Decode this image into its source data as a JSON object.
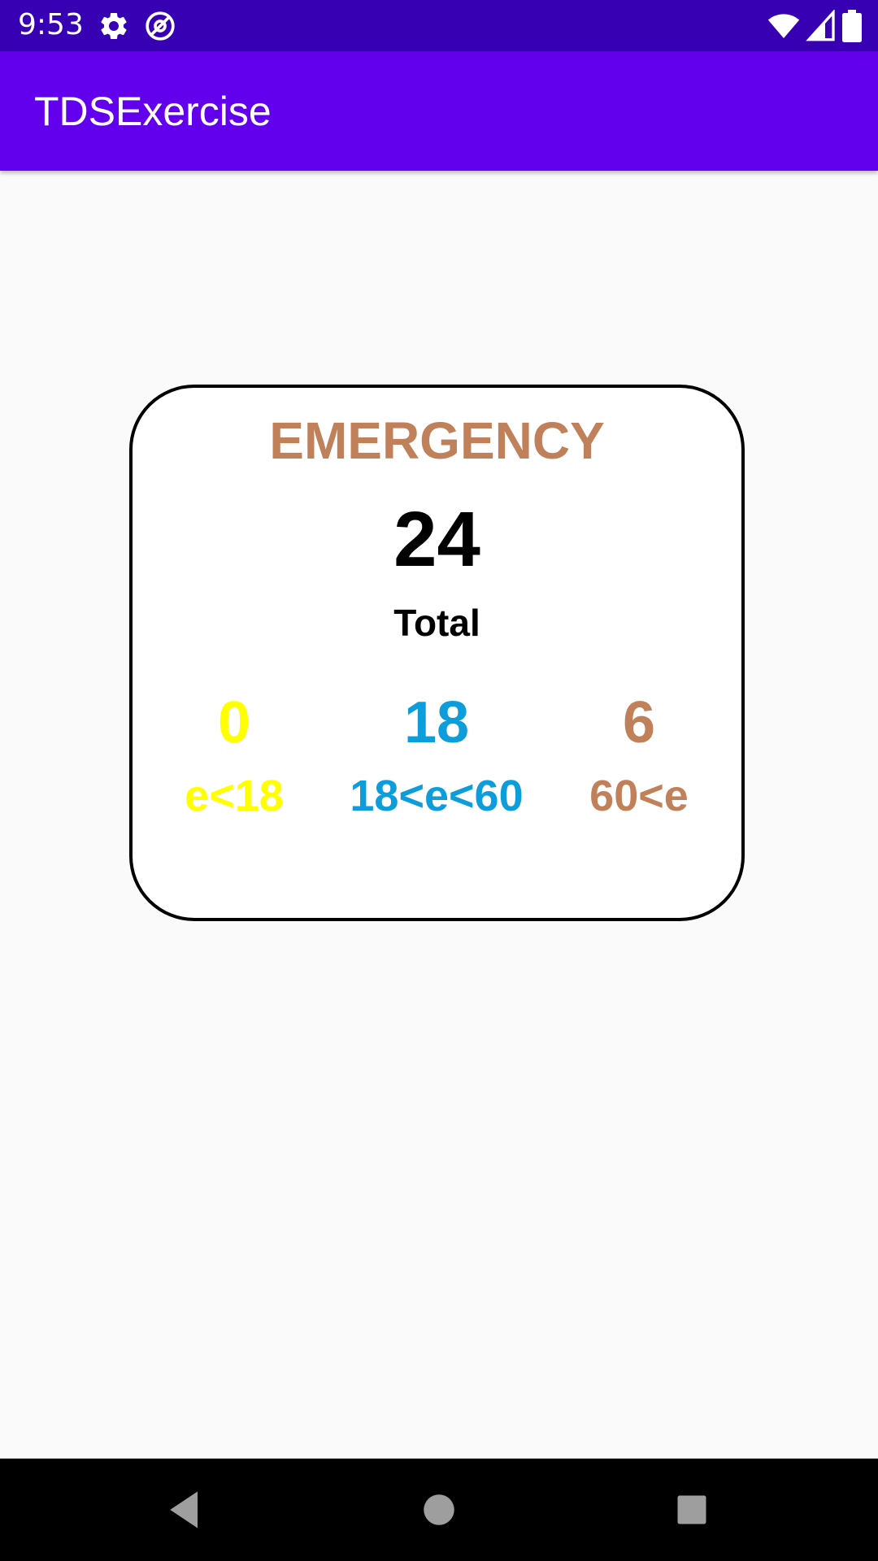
{
  "status_bar": {
    "time": "9:53",
    "icons": [
      "gear-icon",
      "at-sign-icon",
      "wifi-icon",
      "cell-signal-icon",
      "battery-icon"
    ]
  },
  "app_bar": {
    "title": "TDSExercise"
  },
  "card": {
    "title": "EMERGENCY",
    "total_value": "24",
    "total_label": "Total",
    "groups": [
      {
        "value": "0",
        "label": "e<18",
        "color": "#ffff00"
      },
      {
        "value": "18",
        "label": "18<e<60",
        "color": "#0d9ddb"
      },
      {
        "value": "6",
        "label": "60<e",
        "color": "#c0805a"
      }
    ]
  },
  "nav_bar": {
    "buttons": [
      "back-icon",
      "home-icon",
      "recents-icon"
    ]
  },
  "colors": {
    "status_bar": "#3700b3",
    "app_bar": "#6200ee",
    "title_accent": "#c0805a",
    "background": "#fafafa"
  }
}
